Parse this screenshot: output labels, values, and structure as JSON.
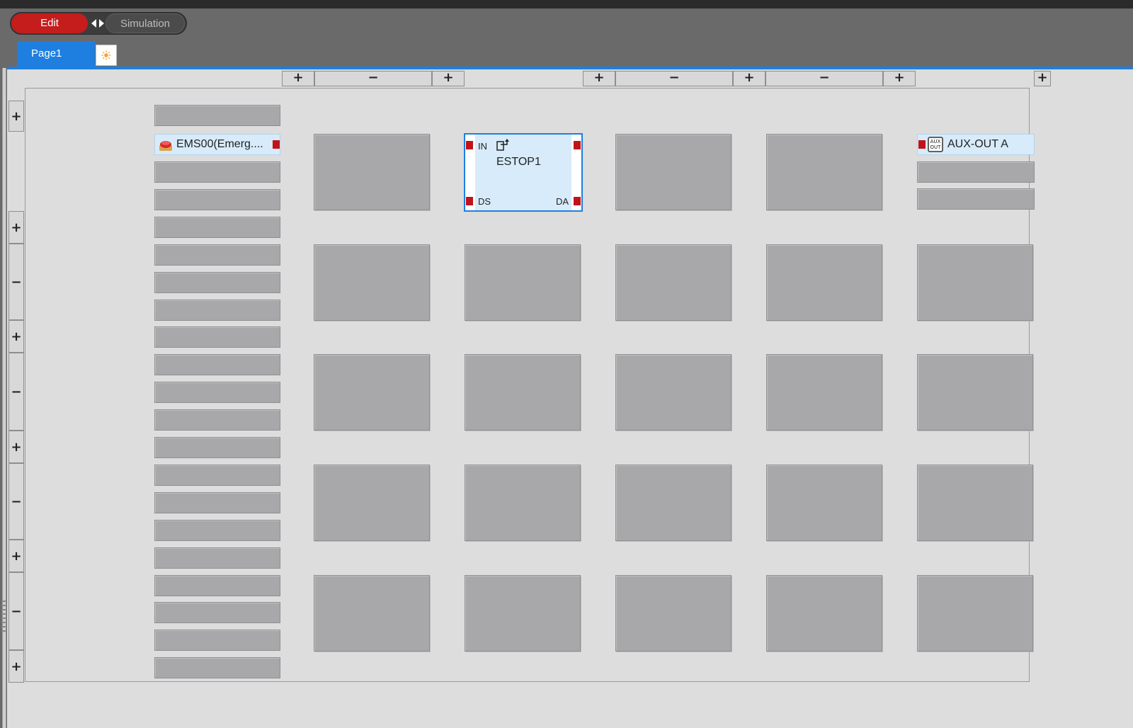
{
  "toolbar": {
    "edit_label": "Edit",
    "simulation_label": "Simulation",
    "active_mode": "Edit"
  },
  "tabs": [
    {
      "label": "Page1",
      "active": true
    }
  ],
  "header_buttons": {
    "plus": "+",
    "minus": "−"
  },
  "inputs": {
    "item_label": "EMS00(Emerg....",
    "icon": "emergency-stop-icon"
  },
  "logic_block": {
    "name": "ESTOP1",
    "port_in": "IN",
    "port_ds": "DS",
    "port_da": "DA",
    "icon": "exit-arrow-icon"
  },
  "outputs": {
    "item_label": "AUX-OUT A",
    "icon": "aux-out-icon",
    "icon_text_top": "AUX",
    "icon_text_bottom": "OUT"
  },
  "colors": {
    "accent": "#1e7fe0",
    "edit_red": "#c51c1c",
    "port_red": "#c0141b",
    "selected_fill": "#d7ebfa",
    "empty_slot": "#a8a7aa"
  }
}
